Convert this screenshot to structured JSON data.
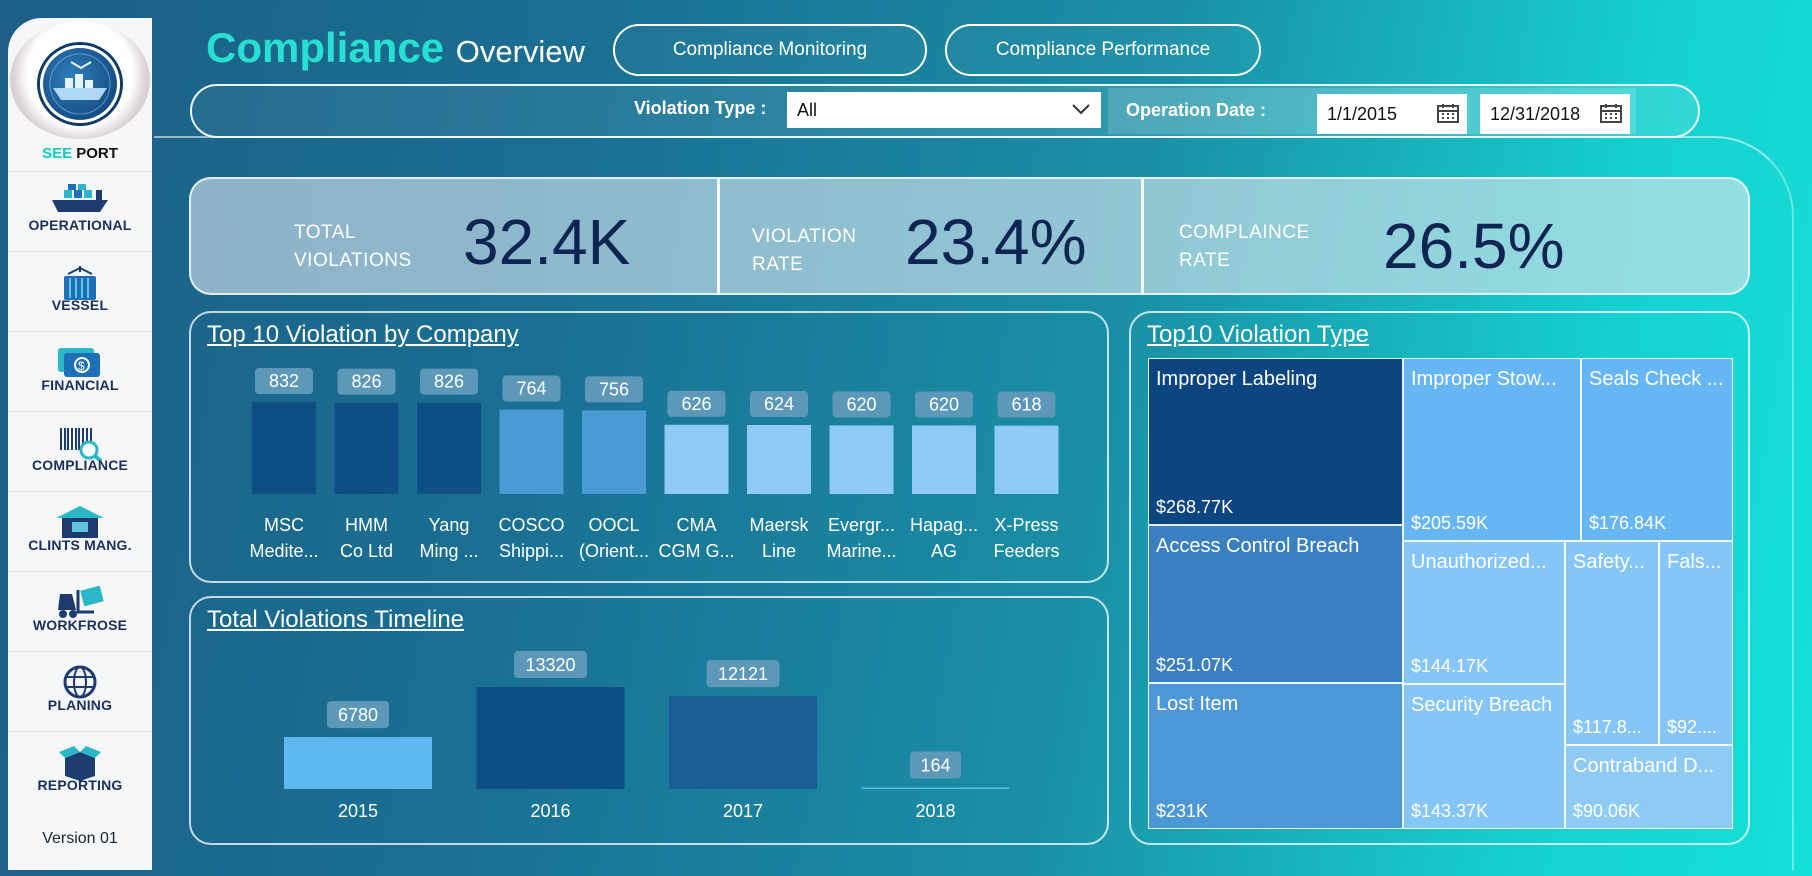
{
  "sidebar": {
    "brand_see": "SEE",
    "brand_port": "PORT",
    "items": [
      {
        "label": "OPERATIONAL",
        "icon": "ship-icon"
      },
      {
        "label": "VESSEL",
        "icon": "container-crane-icon"
      },
      {
        "label": "FINANCIAL",
        "icon": "money-icon"
      },
      {
        "label": "COMPLIANCE",
        "icon": "barcode-search-icon"
      },
      {
        "label": "CLINTS MANG.",
        "icon": "warehouse-icon"
      },
      {
        "label": "WORKFROSE",
        "icon": "forklift-icon"
      },
      {
        "label": "PLANING",
        "icon": "globe-icon"
      },
      {
        "label": "REPORTING",
        "icon": "box-icon"
      }
    ],
    "version": "Version 01"
  },
  "header": {
    "title_main": "Compliance",
    "title_sub": "Overview",
    "tab_monitoring": "Compliance Monitoring",
    "tab_performance": "Compliance Performance"
  },
  "filters": {
    "violation_type_label": "Violation Type :",
    "violation_type_value": "All",
    "operation_date_label": "Operation Date :",
    "date_start": "1/1/2015",
    "date_end": "12/31/2018"
  },
  "kpis": {
    "total_label_1": "TOTAL",
    "total_label_2": "VIOLATIONS",
    "total_value": "32.4K",
    "rate_label_1": "VIOLATION",
    "rate_label_2": "RATE",
    "rate_value": "23.4%",
    "comp_label_1": "COMPLAINCE",
    "comp_label_2": "RATE",
    "comp_value": "26.5%"
  },
  "colors": {
    "dark_blue": "#0d4e85",
    "mid_blue": "#4a9bd4",
    "light_blue": "#8ecaf3",
    "accent_teal": "#28e0d2"
  },
  "chart_data": [
    {
      "type": "bar",
      "title": "Top 10 Violation by Company",
      "categories": [
        [
          "MSC",
          "Medite..."
        ],
        [
          "HMM",
          "Co Ltd"
        ],
        [
          "Yang",
          "Ming ..."
        ],
        [
          "COSCO",
          "Shippi..."
        ],
        [
          "OOCL",
          "(Orient..."
        ],
        [
          "CMA",
          "CGM G..."
        ],
        [
          "Maersk",
          "Line"
        ],
        [
          "Evergr...",
          "Marine..."
        ],
        [
          "Hapag...",
          "AG"
        ],
        [
          "X-Press",
          "Feeders"
        ]
      ],
      "values": [
        832,
        826,
        826,
        764,
        756,
        626,
        624,
        620,
        620,
        618
      ]
    },
    {
      "type": "bar",
      "title": "Total Violations Timeline",
      "categories": [
        "2015",
        "2016",
        "2017",
        "2018"
      ],
      "values": [
        6780,
        13320,
        12121,
        164
      ]
    },
    {
      "type": "heatmap",
      "title": "Top10 Violation Type",
      "tiles": [
        {
          "name": "Improper Labeling",
          "value": "$268.77K"
        },
        {
          "name": "Access Control Breach",
          "value": "$251.07K"
        },
        {
          "name": "Lost Item",
          "value": "$231K"
        },
        {
          "name": "Improper Stow...",
          "value": "$205.59K"
        },
        {
          "name": "Seals Check ...",
          "value": "$176.84K"
        },
        {
          "name": "Unauthorized...",
          "value": "$144.17K"
        },
        {
          "name": "Security Breach",
          "value": "$143.37K"
        },
        {
          "name": "Safety...",
          "value": "$117.8..."
        },
        {
          "name": "Fals...",
          "value": "$92...."
        },
        {
          "name": "Contraband D...",
          "value": "$90.06K"
        }
      ]
    }
  ]
}
